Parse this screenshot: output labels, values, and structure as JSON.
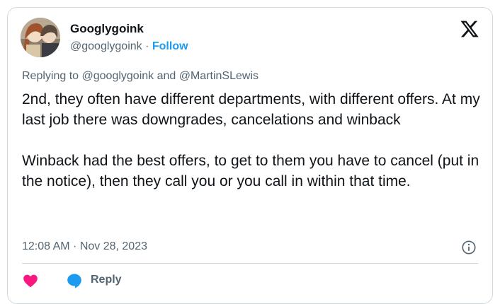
{
  "author": {
    "display_name": "Googlygoink",
    "handle": "@googlygoink",
    "separator": "·",
    "follow_label": "Follow"
  },
  "reply_context": {
    "prefix": "Replying to ",
    "mention_1": "@googlygoink",
    "conjunction": " and ",
    "mention_2": "@MartinSLewis"
  },
  "tweet": {
    "text": "2nd, they often have different departments, with different offers.  At my last job there was downgrades, cancelations and winback\n\nWinback had the best offers, to get to them you have to cancel (put in the notice), then they call you or you call in within that time."
  },
  "meta": {
    "timestamp": "12:08 AM · Nov 28, 2023"
  },
  "actions": {
    "reply_label": "Reply"
  },
  "icons": {
    "brand": "x-logo-icon",
    "info": "info-icon",
    "like": "heart-icon",
    "reply": "reply-bubble-icon"
  },
  "colors": {
    "accent": "#1d9bf0",
    "like": "#f91880",
    "muted": "#536471",
    "text": "#0f1419",
    "border": "#cfd9de"
  }
}
